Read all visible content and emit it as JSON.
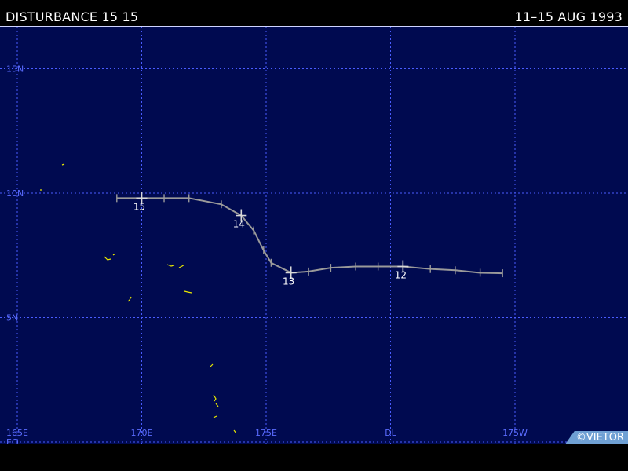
{
  "header": {
    "title": "DISTURBANCE 15 15",
    "dates": "11–15 AUG 1993"
  },
  "copyright": "©VIETOR",
  "map": {
    "lon_range": [
      165,
      185
    ],
    "lat_range": [
      0,
      16.5
    ],
    "grid": true,
    "meridians": [
      {
        "lon": 165,
        "label": "165E"
      },
      {
        "lon": 170,
        "label": "170E"
      },
      {
        "lon": 175,
        "label": "175E"
      },
      {
        "lon": 180,
        "label": "DL"
      },
      {
        "lon": 185,
        "label": "175W"
      }
    ],
    "parallels": [
      {
        "lat": 0,
        "label": "EQ"
      },
      {
        "lat": 5,
        "label": "5N"
      },
      {
        "lat": 10,
        "label": "10N"
      },
      {
        "lat": 15,
        "label": "15N"
      }
    ],
    "colors": {
      "ocean": "#000a50",
      "grid": "#4a5cff",
      "labels": "#5a6cff",
      "track": "#9a9a9a",
      "land": "#e8e800",
      "text": "#ffffff"
    },
    "track": [
      {
        "lon": 184.5,
        "lat": 6.78
      },
      {
        "lon": 183.6,
        "lat": 6.8
      },
      {
        "lon": 182.6,
        "lat": 6.9
      },
      {
        "lon": 181.6,
        "lat": 6.95
      },
      {
        "lon": 180.5,
        "lat": 7.05
      },
      {
        "lon": 179.5,
        "lat": 7.05
      },
      {
        "lon": 178.6,
        "lat": 7.05
      },
      {
        "lon": 177.6,
        "lat": 7.0
      },
      {
        "lon": 176.7,
        "lat": 6.85
      },
      {
        "lon": 176.0,
        "lat": 6.8
      },
      {
        "lon": 175.2,
        "lat": 7.2
      },
      {
        "lon": 174.9,
        "lat": 7.7
      },
      {
        "lon": 174.5,
        "lat": 8.5
      },
      {
        "lon": 174.0,
        "lat": 9.1
      },
      {
        "lon": 173.2,
        "lat": 9.55
      },
      {
        "lon": 171.9,
        "lat": 9.8
      },
      {
        "lon": 170.9,
        "lat": 9.8
      },
      {
        "lon": 170.0,
        "lat": 9.8
      },
      {
        "lon": 169.0,
        "lat": 9.8
      }
    ],
    "day_markers": [
      {
        "label": "12",
        "lon": 180.5,
        "lat": 7.05
      },
      {
        "label": "13",
        "lon": 176.0,
        "lat": 6.8
      },
      {
        "label": "14",
        "lon": 174.0,
        "lat": 9.1
      },
      {
        "label": "15",
        "lon": 170.0,
        "lat": 9.8
      }
    ]
  }
}
